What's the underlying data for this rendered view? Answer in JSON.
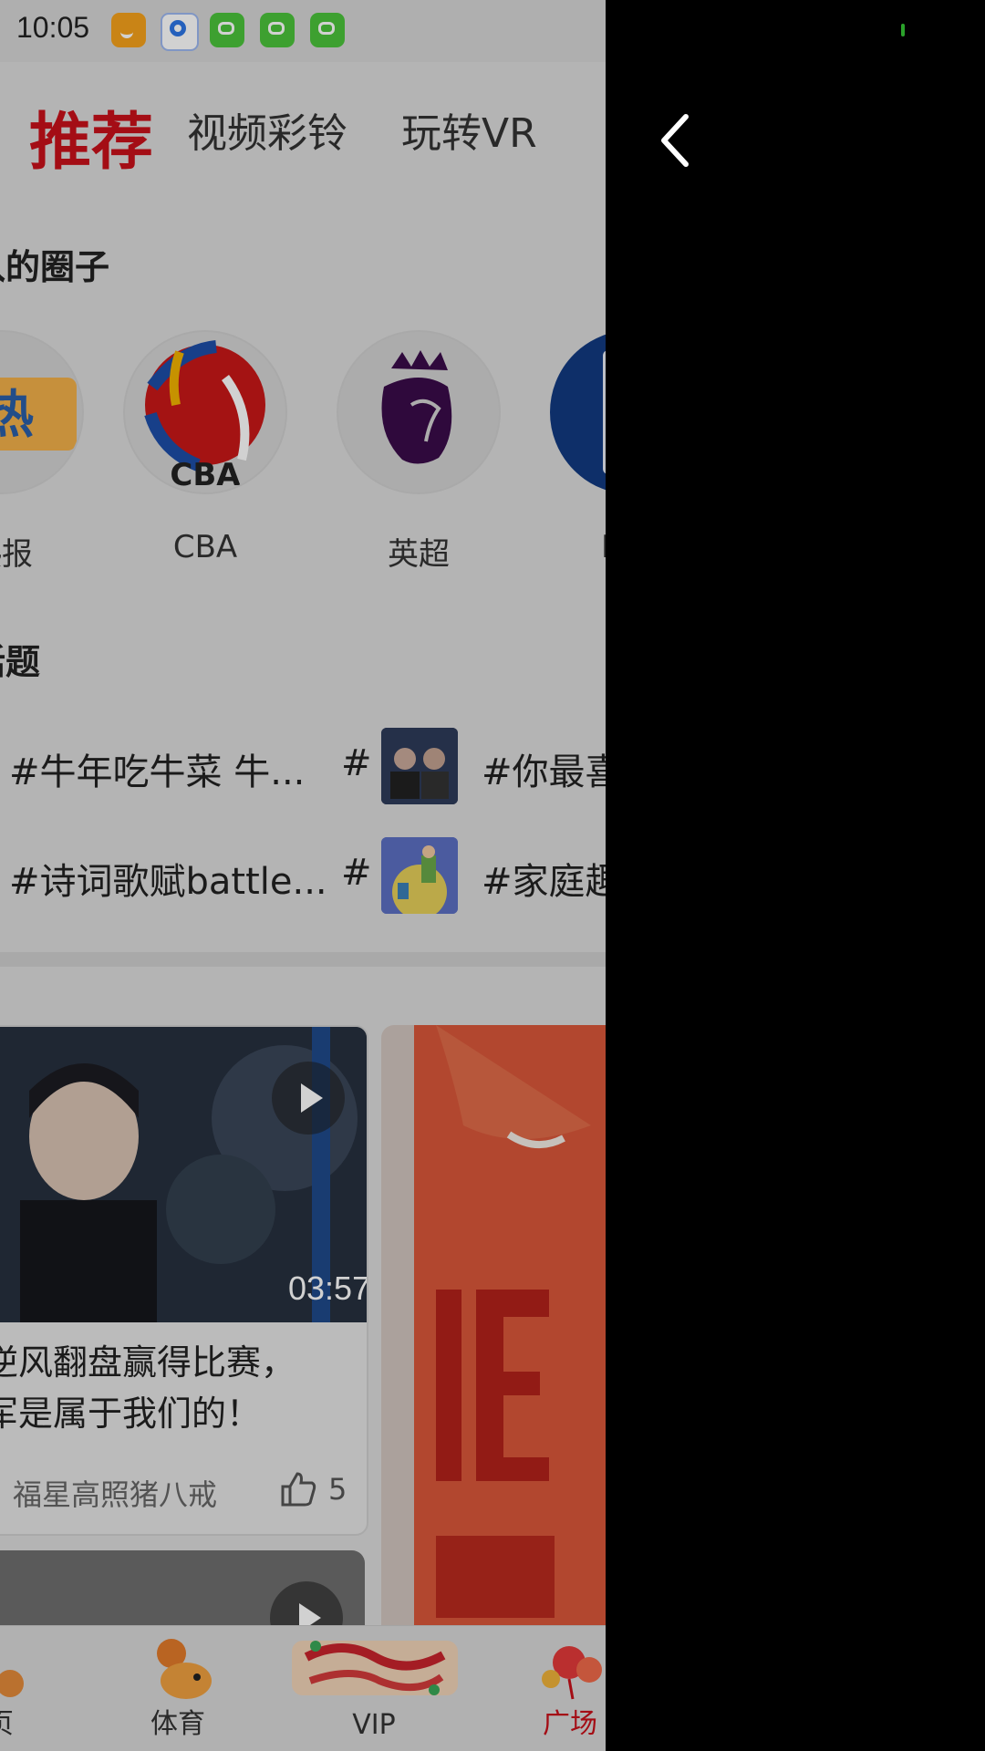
{
  "status_bar": {
    "time": "10:05"
  },
  "tabs": [
    {
      "label": "推荐",
      "active": true
    },
    {
      "label": "视频彩铃",
      "active": false
    },
    {
      "label": "玩转VR",
      "active": false
    }
  ],
  "circles": {
    "title": "入的圈子",
    "items": [
      {
        "label": "热报",
        "icon": "news-icon"
      },
      {
        "label": "CBA",
        "icon": "cba-logo-icon"
      },
      {
        "label": "英超",
        "icon": "premier-league-lion-icon"
      },
      {
        "label": "N",
        "icon": "nba-logo-icon"
      }
    ]
  },
  "topics": {
    "title": "话题",
    "rows": [
      {
        "left": "#牛年吃牛菜 牛...",
        "hash": "#",
        "right": "#你最喜"
      },
      {
        "left": "#诗词歌赋battle...",
        "hash": "#",
        "right": "#家庭趣"
      }
    ]
  },
  "cards": [
    {
      "duration": "03:57",
      "title_line1": "逆风翻盘赢得比赛，",
      "title_line2": "军是属于我们的！",
      "author": "福星高照猪八戒",
      "likes": "5"
    }
  ],
  "bottom_nav": [
    {
      "label": "页",
      "active": false
    },
    {
      "label": "体育",
      "active": false
    },
    {
      "label": "VIP",
      "active": false
    },
    {
      "label": "广场",
      "active": true
    }
  ],
  "colors": {
    "accent": "#c8101a"
  }
}
